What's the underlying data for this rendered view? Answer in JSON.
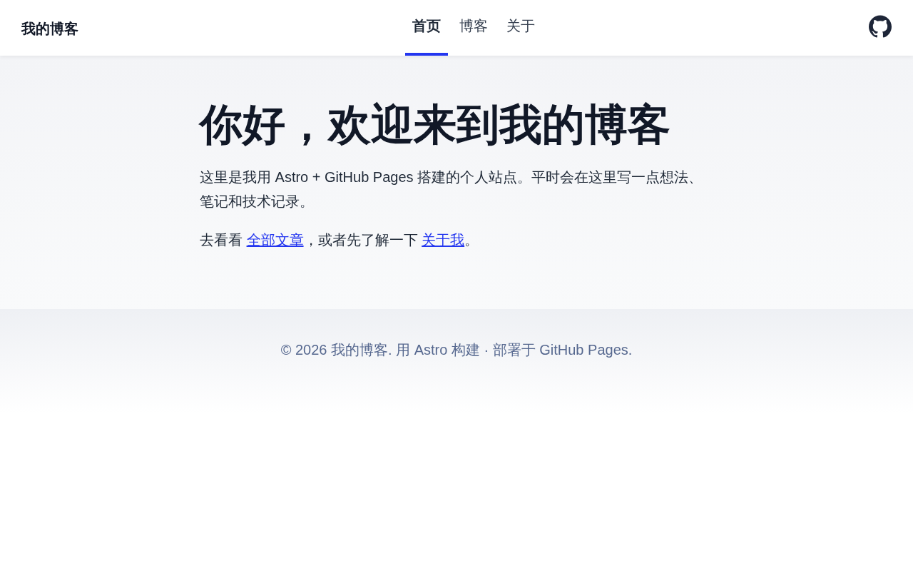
{
  "header": {
    "site_title": "我的博客",
    "nav": [
      {
        "label": "首页",
        "selected": true
      },
      {
        "label": "博客",
        "selected": false
      },
      {
        "label": "关于",
        "selected": false
      }
    ]
  },
  "hero": {
    "title": "你好，欢迎来到我的博客",
    "intro": "这里是我用 Astro + GitHub Pages 搭建的个人站点。平时会在这里写一点想法、笔记和技术记录。",
    "links_sentence": [
      {
        "kind": "text",
        "text": "去看看 "
      },
      {
        "kind": "link",
        "text": "全部文章"
      },
      {
        "kind": "text",
        "text": "，或者先了解一下 "
      },
      {
        "kind": "link",
        "text": "关于我"
      },
      {
        "kind": "text",
        "text": "。"
      }
    ]
  },
  "footer": {
    "text": "© 2026 我的博客. 用 Astro 构建 · 部署于 GitHub Pages."
  }
}
